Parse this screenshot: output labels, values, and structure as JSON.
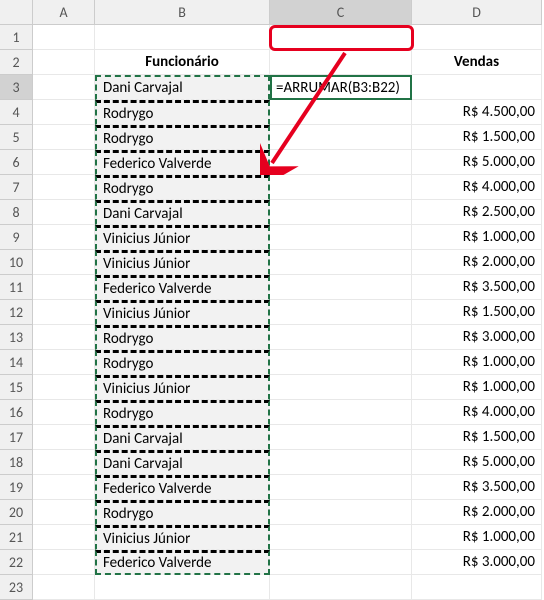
{
  "columns": [
    "A",
    "B",
    "C",
    "D"
  ],
  "rowCount": 23,
  "selectedColumn": "C",
  "selectedRow": 3,
  "headers": {
    "col_b": "Funcionário",
    "col_d": "Vendas"
  },
  "formula": {
    "prefix": "=ARRUMAR(",
    "ref": "B3:B22",
    "suffix": ")"
  },
  "rangeB": {
    "from": 3,
    "to": 22
  },
  "data": [
    {
      "b": "Dani  Carvajal",
      "d": ""
    },
    {
      "b": "Rodrygo",
      "d": "R$ 4.500,00"
    },
    {
      "b": "Rodrygo",
      "d": "R$ 1.500,00"
    },
    {
      "b": "Federico  Valverde",
      "d": "R$ 5.000,00"
    },
    {
      "b": "Rodrygo",
      "d": "R$ 4.000,00"
    },
    {
      "b": "Dani  Carvajal",
      "d": "R$ 2.500,00"
    },
    {
      "b": "Vinicius Júnior",
      "d": "R$ 1.000,00"
    },
    {
      "b": "Vinicius Júnior",
      "d": "R$ 2.000,00"
    },
    {
      "b": "Federico Valverde",
      "d": "R$ 3.500,00"
    },
    {
      "b": "Vinicius Júnior",
      "d": "R$ 1.500,00"
    },
    {
      "b": "Rodrygo",
      "d": "R$ 3.000,00"
    },
    {
      "b": "Rodrygo",
      "d": "R$ 1.000,00"
    },
    {
      "b": "Vinicius Júnior",
      "d": "R$ 1.000,00"
    },
    {
      "b": "Rodrygo",
      "d": "R$ 4.000,00"
    },
    {
      "b": "Dani  Carvajal",
      "d": "R$ 1.500,00"
    },
    {
      "b": "Dani Carvajal",
      "d": "R$ 5.000,00"
    },
    {
      "b": "Federico  Valverde",
      "d": "R$ 3.500,00"
    },
    {
      "b": "Rodrygo",
      "d": "R$ 2.000,00"
    },
    {
      "b": "Vinicius Júnior",
      "d": "R$ 1.000,00"
    },
    {
      "b": "Federico Valverde",
      "d": "R$ 3.000,00"
    }
  ],
  "chart_data": {
    "type": "table",
    "title": "Funcionário Vendas",
    "columns": [
      "Funcionário",
      "Vendas (R$)"
    ],
    "rows": [
      [
        "Dani Carvajal",
        null
      ],
      [
        "Rodrygo",
        4500.0
      ],
      [
        "Rodrygo",
        1500.0
      ],
      [
        "Federico Valverde",
        5000.0
      ],
      [
        "Rodrygo",
        4000.0
      ],
      [
        "Dani Carvajal",
        2500.0
      ],
      [
        "Vinicius Júnior",
        1000.0
      ],
      [
        "Vinicius Júnior",
        2000.0
      ],
      [
        "Federico Valverde",
        3500.0
      ],
      [
        "Vinicius Júnior",
        1500.0
      ],
      [
        "Rodrygo",
        3000.0
      ],
      [
        "Rodrygo",
        1000.0
      ],
      [
        "Vinicius Júnior",
        1000.0
      ],
      [
        "Rodrygo",
        4000.0
      ],
      [
        "Dani Carvajal",
        1500.0
      ],
      [
        "Dani Carvajal",
        5000.0
      ],
      [
        "Federico Valverde",
        3500.0
      ],
      [
        "Rodrygo",
        2000.0
      ],
      [
        "Vinicius Júnior",
        1000.0
      ],
      [
        "Federico Valverde",
        3000.0
      ]
    ]
  }
}
